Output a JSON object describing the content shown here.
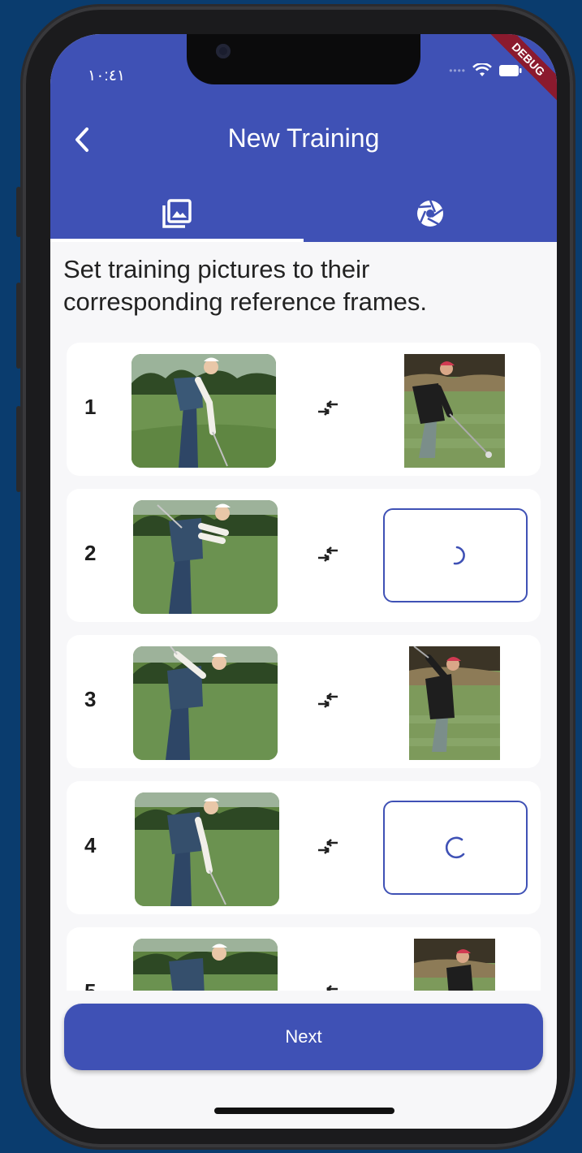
{
  "status_bar": {
    "time": "١٠:٤١",
    "debug_label": "DEBUG"
  },
  "app_bar": {
    "title": "New Training",
    "back_icon": "chevron-left-icon"
  },
  "tabs": [
    {
      "icon": "photo-library-icon",
      "selected": true
    },
    {
      "icon": "camera-shutter-icon",
      "selected": false
    }
  ],
  "instruction": "Set training pictures to their corresponding reference frames.",
  "rows": [
    {
      "number": "1",
      "reference_state": "image"
    },
    {
      "number": "2",
      "reference_state": "loading"
    },
    {
      "number": "3",
      "reference_state": "image"
    },
    {
      "number": "4",
      "reference_state": "loading"
    },
    {
      "number": "5",
      "reference_state": "image"
    }
  ],
  "next_label": "Next",
  "colors": {
    "primary": "#3f51b5",
    "background": "#f7f7f9",
    "card": "#ffffff",
    "debug_banner": "#8b1a2e"
  }
}
